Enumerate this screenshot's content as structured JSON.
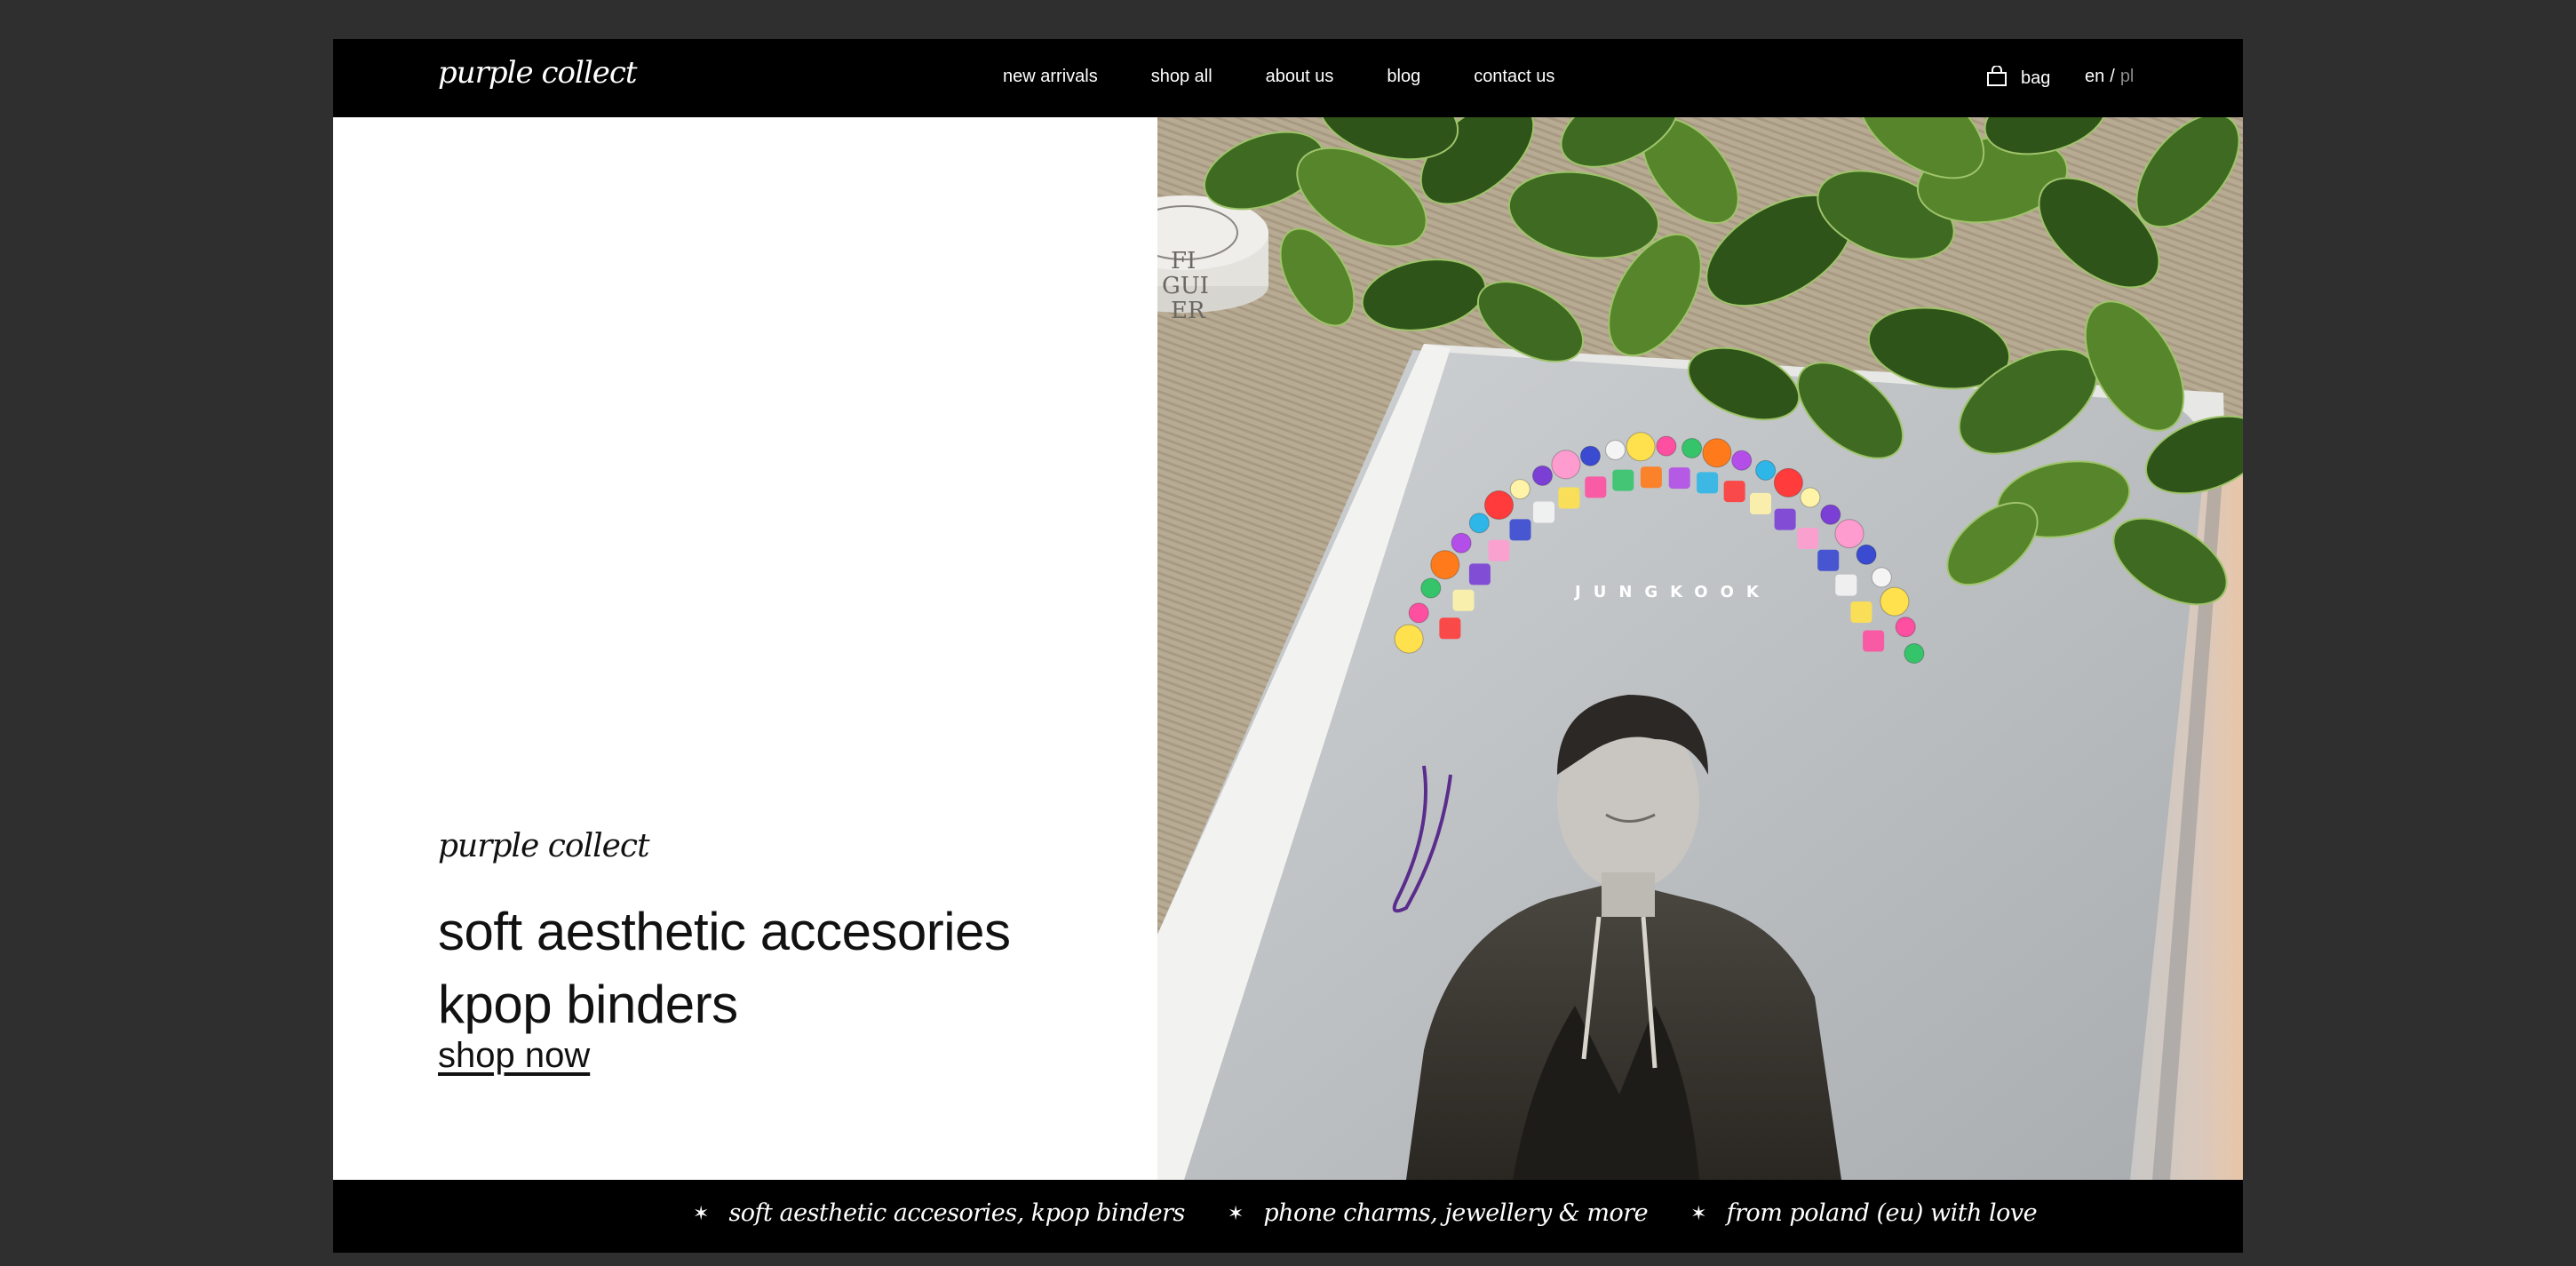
{
  "header": {
    "logo": "purple collect",
    "nav": [
      {
        "label": "new arrivals"
      },
      {
        "label": "shop all"
      },
      {
        "label": "about us"
      },
      {
        "label": "blog"
      },
      {
        "label": "contact us"
      }
    ],
    "bag_label": "bag",
    "bag_icon": "shopping-bag-icon",
    "lang_en": "en",
    "lang_sep": "/",
    "lang_pl": "pl"
  },
  "hero": {
    "brand": "purple collect",
    "tagline_line1": "soft aesthetic accesories",
    "tagline_line2": "kpop binders",
    "cta": "shop now",
    "photo_candle_text_1": "FI",
    "photo_candle_text_2": "GUI",
    "photo_candle_text_3": "ER",
    "photo_bead_text": "JUNGKOOK"
  },
  "ticker": {
    "star_icon": "sparkle-icon",
    "items": [
      "soft aesthetic accesories, kpop binders",
      "phone charms, jewellery & more",
      "from poland (eu) with love"
    ]
  },
  "colors": {
    "page_background": "#2f2f2f",
    "bar_background": "#000000",
    "text_on_bar": "#ffffff",
    "muted_lang": "#8a8a8a",
    "hero_text": "#111111"
  }
}
